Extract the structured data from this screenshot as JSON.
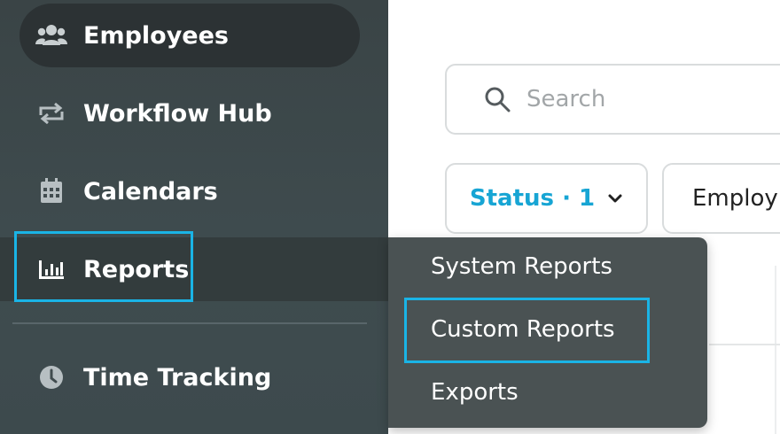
{
  "sidebar": {
    "items": [
      {
        "label": "Employees",
        "icon": "users-icon",
        "active": true
      },
      {
        "label": "Workflow Hub",
        "icon": "repeat-icon"
      },
      {
        "label": "Calendars",
        "icon": "calendar-icon"
      },
      {
        "label": "Reports",
        "icon": "bar-chart-icon",
        "highlighted": true
      },
      {
        "label": "Time Tracking",
        "icon": "clock-icon"
      }
    ]
  },
  "search": {
    "placeholder": "Search"
  },
  "filters": {
    "status_label": "Status · 1",
    "employ_label": "Employ"
  },
  "reports_menu": {
    "items": [
      {
        "label": "System Reports"
      },
      {
        "label": "Custom Reports",
        "highlighted": true
      },
      {
        "label": "Exports"
      }
    ]
  },
  "colors": {
    "sidebar_bg": "#3f4c4f",
    "active_item_bg": "#2c3234",
    "flyout_bg": "#4a5253",
    "accent": "#17a5d4",
    "highlight_border": "#1ab4e6"
  }
}
